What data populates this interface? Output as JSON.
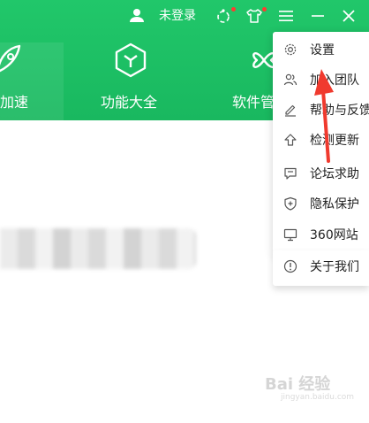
{
  "header": {
    "user_status": "未登录",
    "nav": [
      {
        "label": "加速"
      },
      {
        "label": "功能大全"
      },
      {
        "label": "软件管"
      }
    ]
  },
  "menu": {
    "items": [
      {
        "label": "设置",
        "icon": "gear-icon"
      },
      {
        "label": "加入团队",
        "icon": "team-icon"
      },
      {
        "label": "帮助与反馈",
        "icon": "edit-icon"
      },
      {
        "label": "检测更新",
        "icon": "upload-arrow-icon"
      },
      {
        "label": "论坛求助",
        "icon": "chat-icon"
      },
      {
        "label": "隐私保护",
        "icon": "shield-plus-icon"
      },
      {
        "label": "360网站",
        "icon": "monitor-icon"
      },
      {
        "label": "关于我们",
        "icon": "info-icon"
      }
    ]
  },
  "colors": {
    "header_green": "#1fc268",
    "menu_text": "#222222",
    "arrow_red": "#f03a2e",
    "notification_dot": "#ff3b30"
  },
  "watermark": {
    "brand": "Bai 经验",
    "sub": "jingyan.baidu.com"
  }
}
